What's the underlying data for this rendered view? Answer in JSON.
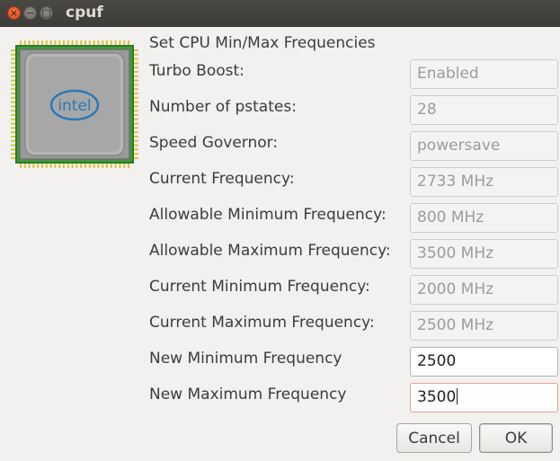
{
  "window": {
    "title": "cpuf"
  },
  "icons": {
    "close": "close-icon",
    "minimize": "minimize-icon",
    "maximize": "maximize-icon",
    "cpu": "intel-cpu-icon"
  },
  "logo_text": "intel",
  "heading": "Set CPU Min/Max Frequencies",
  "rows": [
    {
      "label": "Turbo Boost:",
      "value": "Enabled"
    },
    {
      "label": "Number of pstates:",
      "value": "28"
    },
    {
      "label": "Speed Governor:",
      "value": "powersave"
    },
    {
      "label": "Current Frequency:",
      "value": "2733 MHz"
    },
    {
      "label": "Allowable Minimum Frequency:",
      "value": "800 MHz"
    },
    {
      "label": "Allowable Maximum Frequency:",
      "value": "3500 MHz"
    },
    {
      "label": "Current Minimum Frequency:",
      "value": "2000 MHz"
    },
    {
      "label": "Current Maximum Frequency:",
      "value": "2500 MHz"
    },
    {
      "label": "New Minimum Frequency",
      "value": "2500"
    },
    {
      "label": "New Maximum Frequency",
      "value": "3500"
    }
  ],
  "buttons": {
    "cancel": "Cancel",
    "ok": "OK"
  },
  "colors": {
    "focus_border": "#e7a08c",
    "close_button": "#e8582a",
    "chip_green": "#2e8b3a",
    "intel_blue": "#2a7ab8"
  }
}
